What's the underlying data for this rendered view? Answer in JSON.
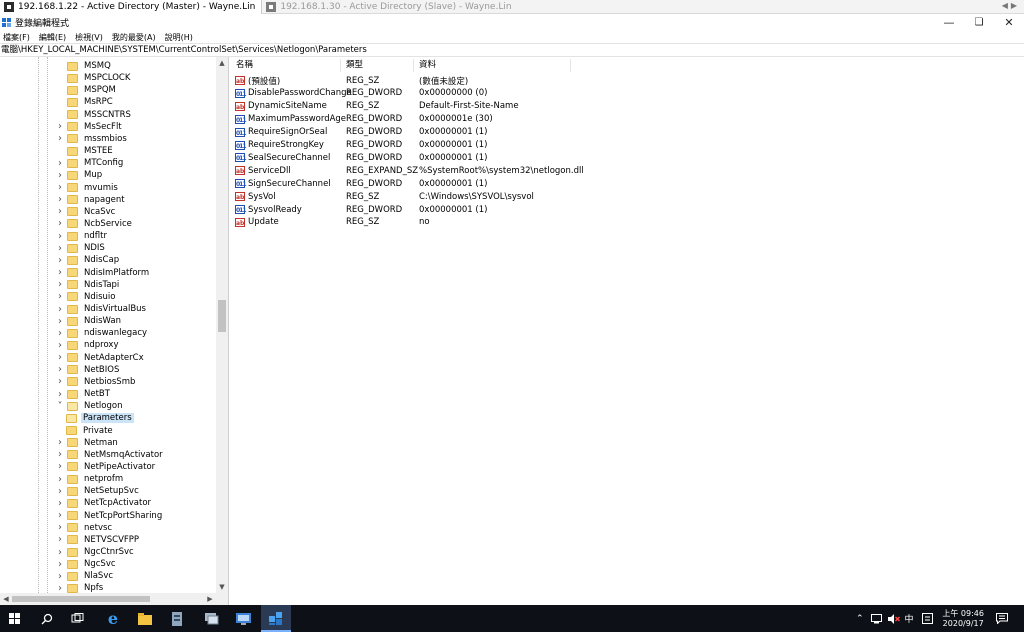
{
  "remote_tabs": [
    {
      "label": "192.168.1.22 - Active Directory (Master) - Wayne.Lin",
      "active": true
    },
    {
      "label": "192.168.1.30 - Active Directory (Slave) - Wayne.Lin",
      "active": false
    }
  ],
  "window": {
    "title": "登錄編輯程式"
  },
  "menu": [
    "檔案(F)",
    "編輯(E)",
    "檢視(V)",
    "我的最愛(A)",
    "說明(H)"
  ],
  "address": "電腦\\HKEY_LOCAL_MACHINE\\SYSTEM\\CurrentControlSet\\Services\\Netlogon\\Parameters",
  "tree": [
    {
      "label": "MSMQ",
      "expander": "none"
    },
    {
      "label": "MSPCLOCK",
      "expander": "none"
    },
    {
      "label": "MSPQM",
      "expander": "none"
    },
    {
      "label": "MsRPC",
      "expander": "none"
    },
    {
      "label": "MSSCNTRS",
      "expander": "none"
    },
    {
      "label": "MsSecFlt",
      "expander": "collapsed"
    },
    {
      "label": "mssmbios",
      "expander": "collapsed"
    },
    {
      "label": "MSTEE",
      "expander": "none"
    },
    {
      "label": "MTConfig",
      "expander": "collapsed"
    },
    {
      "label": "Mup",
      "expander": "collapsed"
    },
    {
      "label": "mvumis",
      "expander": "collapsed"
    },
    {
      "label": "napagent",
      "expander": "collapsed"
    },
    {
      "label": "NcaSvc",
      "expander": "collapsed"
    },
    {
      "label": "NcbService",
      "expander": "collapsed"
    },
    {
      "label": "ndfltr",
      "expander": "collapsed"
    },
    {
      "label": "NDIS",
      "expander": "collapsed"
    },
    {
      "label": "NdisCap",
      "expander": "collapsed"
    },
    {
      "label": "NdisImPlatform",
      "expander": "collapsed"
    },
    {
      "label": "NdisTapi",
      "expander": "collapsed"
    },
    {
      "label": "Ndisuio",
      "expander": "collapsed"
    },
    {
      "label": "NdisVirtualBus",
      "expander": "collapsed"
    },
    {
      "label": "NdisWan",
      "expander": "collapsed"
    },
    {
      "label": "ndiswanlegacy",
      "expander": "collapsed"
    },
    {
      "label": "ndproxy",
      "expander": "collapsed"
    },
    {
      "label": "NetAdapterCx",
      "expander": "collapsed"
    },
    {
      "label": "NetBIOS",
      "expander": "collapsed"
    },
    {
      "label": "NetbiosSmb",
      "expander": "collapsed"
    },
    {
      "label": "NetBT",
      "expander": "collapsed"
    },
    {
      "label": "Netlogon",
      "expander": "expanded"
    },
    {
      "label": "Parameters",
      "expander": "child",
      "selected": true
    },
    {
      "label": "Private",
      "expander": "child"
    },
    {
      "label": "Netman",
      "expander": "collapsed"
    },
    {
      "label": "NetMsmqActivator",
      "expander": "collapsed"
    },
    {
      "label": "NetPipeActivator",
      "expander": "collapsed"
    },
    {
      "label": "netprofm",
      "expander": "collapsed"
    },
    {
      "label": "NetSetupSvc",
      "expander": "collapsed"
    },
    {
      "label": "NetTcpActivator",
      "expander": "collapsed"
    },
    {
      "label": "NetTcpPortSharing",
      "expander": "collapsed"
    },
    {
      "label": "netvsc",
      "expander": "collapsed"
    },
    {
      "label": "NETVSCVFPP",
      "expander": "collapsed"
    },
    {
      "label": "NgcCtnrSvc",
      "expander": "collapsed"
    },
    {
      "label": "NgcSvc",
      "expander": "collapsed"
    },
    {
      "label": "NlaSvc",
      "expander": "collapsed"
    },
    {
      "label": "Npfs",
      "expander": "collapsed"
    }
  ],
  "columns": [
    "名稱",
    "類型",
    "資料"
  ],
  "values": [
    {
      "icon": "ab",
      "name": "(預設值)",
      "type": "REG_SZ",
      "data": "(數值未設定)"
    },
    {
      "icon": "bin",
      "name": "DisablePasswordChange",
      "type": "REG_DWORD",
      "data": "0x00000000 (0)"
    },
    {
      "icon": "ab",
      "name": "DynamicSiteName",
      "type": "REG_SZ",
      "data": "Default-First-Site-Name"
    },
    {
      "icon": "bin",
      "name": "MaximumPasswordAge",
      "type": "REG_DWORD",
      "data": "0x0000001e (30)"
    },
    {
      "icon": "bin",
      "name": "RequireSignOrSeal",
      "type": "REG_DWORD",
      "data": "0x00000001 (1)"
    },
    {
      "icon": "bin",
      "name": "RequireStrongKey",
      "type": "REG_DWORD",
      "data": "0x00000001 (1)"
    },
    {
      "icon": "bin",
      "name": "SealSecureChannel",
      "type": "REG_DWORD",
      "data": "0x00000001 (1)"
    },
    {
      "icon": "ab",
      "name": "ServiceDll",
      "type": "REG_EXPAND_SZ",
      "data": "%SystemRoot%\\system32\\netlogon.dll"
    },
    {
      "icon": "bin",
      "name": "SignSecureChannel",
      "type": "REG_DWORD",
      "data": "0x00000001 (1)"
    },
    {
      "icon": "ab",
      "name": "SysVol",
      "type": "REG_SZ",
      "data": "C:\\Windows\\SYSVOL\\sysvol"
    },
    {
      "icon": "bin",
      "name": "SysvolReady",
      "type": "REG_DWORD",
      "data": "0x00000001 (1)"
    },
    {
      "icon": "ab",
      "name": "Update",
      "type": "REG_SZ",
      "data": "no"
    }
  ],
  "taskbar": {
    "apps": [
      "start-icon",
      "search-icon",
      "task-view-icon",
      "internet-explorer-icon",
      "file-explorer-icon",
      "server-manager-icon",
      "network-icon",
      "remote-desktop-icon",
      "registry-editor-icon"
    ],
    "ime": "中",
    "time": "上午 09:46",
    "date": "2020/9/17"
  }
}
